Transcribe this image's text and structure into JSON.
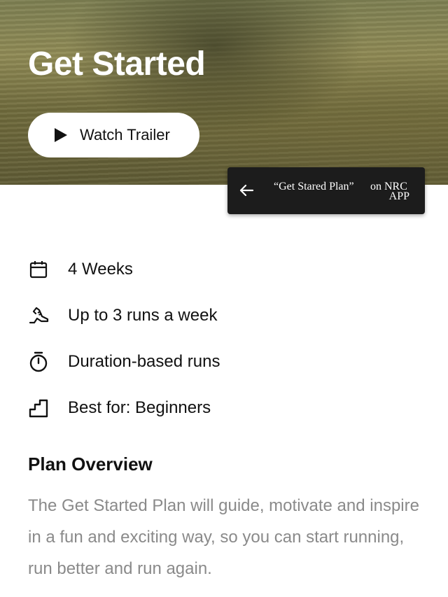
{
  "hero": {
    "title": "Get Started",
    "trailer_button_label": "Watch Trailer"
  },
  "nrc_banner": {
    "text_quote": "“Get Stared Plan”",
    "text_on": "on NRC",
    "text_app": "APP"
  },
  "features": [
    {
      "icon": "calendar-icon",
      "label": "4 Weeks"
    },
    {
      "icon": "running-shoe-icon",
      "label": "Up to 3 runs a week"
    },
    {
      "icon": "stopwatch-icon",
      "label": "Duration-based runs"
    },
    {
      "icon": "stairs-icon",
      "label": "Best for: Beginners"
    }
  ],
  "overview": {
    "title": "Plan Overview",
    "body": "The Get Started Plan will guide, motivate and inspire in a fun and exciting way, so you can start running, run better and run again."
  }
}
